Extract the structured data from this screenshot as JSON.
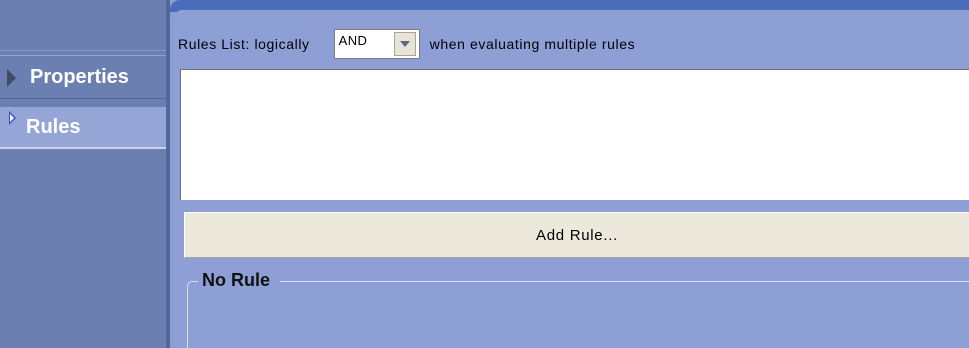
{
  "sidebar": {
    "items": [
      {
        "label": "Properties",
        "icon": "collapsed-triangle-icon",
        "active": false
      },
      {
        "label": "Rules",
        "icon": "active-triangle-icon",
        "active": true
      }
    ]
  },
  "rules_panel": {
    "prefix_text": "Rules List: logically",
    "logic_select": {
      "value": "AND"
    },
    "suffix_text": "when evaluating multiple rules",
    "add_rule_label": "Add Rule...",
    "group_title": "No Rule"
  },
  "colors": {
    "sidebar_bg": "#6b7fb1",
    "active_nav_bg": "#95a6d6",
    "panel_bg": "#8d9fd4",
    "panel_top_border": "#4b6cb8",
    "button_bg": "#ece9dc"
  }
}
